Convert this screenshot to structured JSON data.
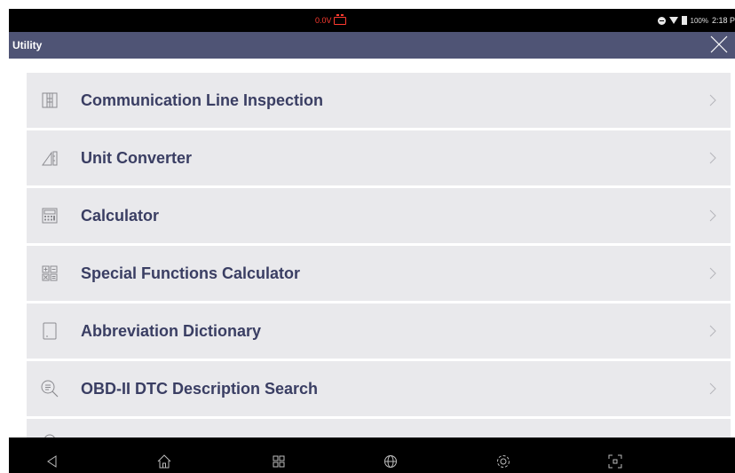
{
  "status_bar": {
    "voltage": "0.0V",
    "battery_percent": "100%",
    "time": "2:18 P"
  },
  "header": {
    "title": "Utility"
  },
  "items": [
    {
      "label": "Communication Line Inspection",
      "icon": "communication-line-icon"
    },
    {
      "label": "Unit Converter",
      "icon": "unit-converter-icon"
    },
    {
      "label": "Calculator",
      "icon": "calculator-icon"
    },
    {
      "label": "Special Functions Calculator",
      "icon": "special-functions-icon"
    },
    {
      "label": "Abbreviation Dictionary",
      "icon": "tablet-icon"
    },
    {
      "label": "OBD-II DTC Description Search",
      "icon": "search-icon"
    }
  ],
  "nav": [
    "back-icon",
    "home-icon",
    "recent-apps-icon",
    "browser-icon",
    "settings-icon",
    "screenshot-icon"
  ],
  "colors": {
    "title_bar": "#4f5475",
    "item_bg": "#e9e9ec",
    "item_text": "#3a3e63",
    "voltage_warning": "#ff3b30"
  }
}
